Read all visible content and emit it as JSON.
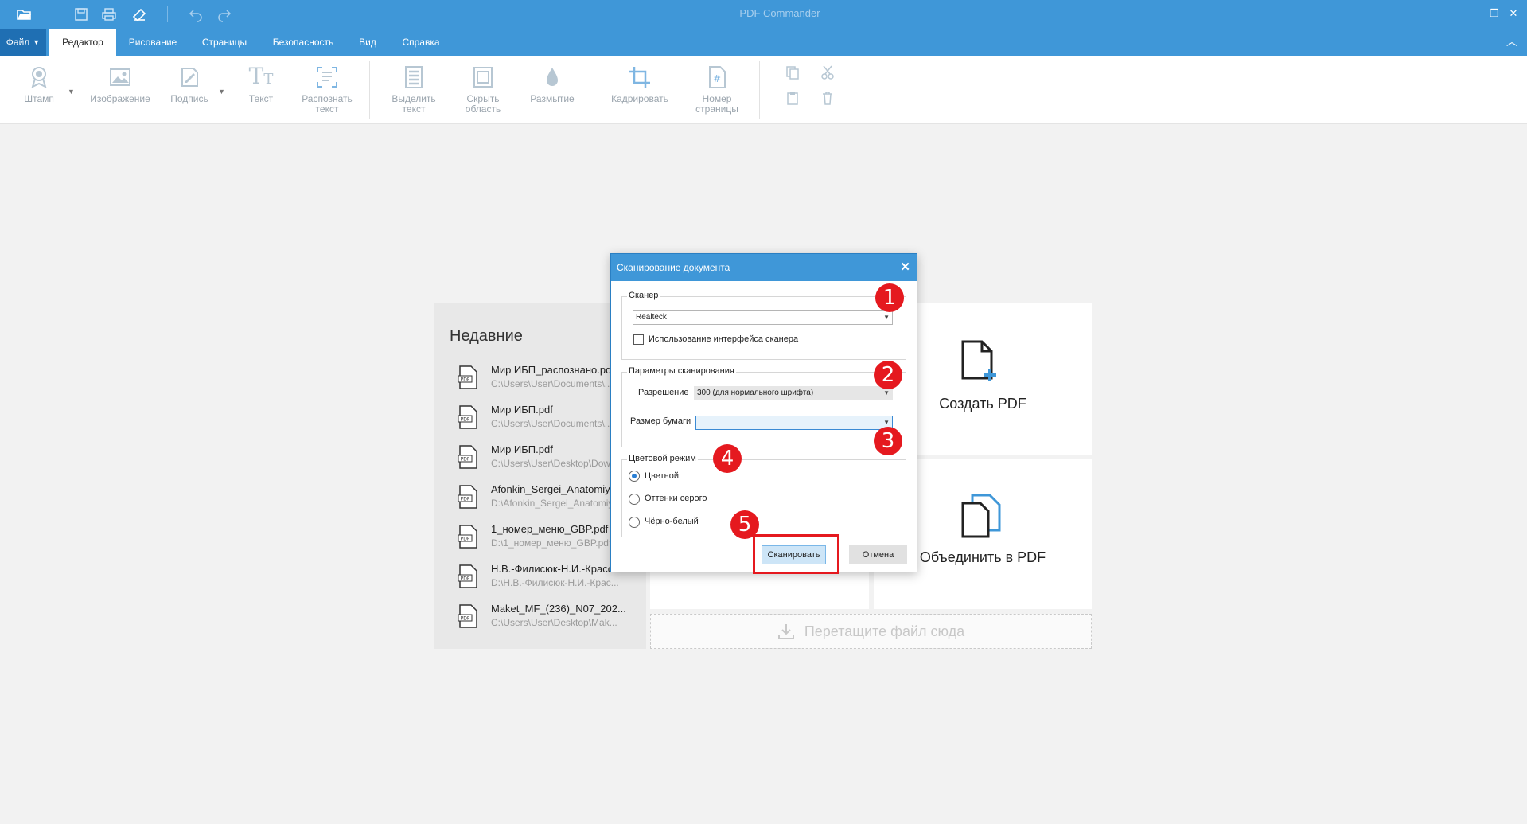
{
  "app": {
    "title": "PDF Commander"
  },
  "menu": {
    "file_label": "Файл",
    "tabs": [
      "Редактор",
      "Рисование",
      "Страницы",
      "Безопасность",
      "Вид",
      "Справка"
    ]
  },
  "ribbon": {
    "stamp": "Штамп",
    "image": "Изображение",
    "signature": "Подпись",
    "text": "Текст",
    "recognize": [
      "Распознать",
      "текст"
    ],
    "highlight": [
      "Выделить",
      "текст"
    ],
    "hide_area": [
      "Скрыть",
      "область"
    ],
    "blur": "Размытие",
    "crop": "Кадрировать",
    "page_number": [
      "Номер",
      "страницы"
    ]
  },
  "recent": {
    "title": "Недавние",
    "items": [
      {
        "name": "Мир ИБП_распознано.pdf",
        "path": "C:\\Users\\User\\Documents\\..."
      },
      {
        "name": "Мир ИБП.pdf",
        "path": "C:\\Users\\User\\Documents\\..."
      },
      {
        "name": "Мир ИБП.pdf",
        "path": "C:\\Users\\User\\Desktop\\Dow..."
      },
      {
        "name": "Afonkin_Sergei_Anatomiya...",
        "path": "D:\\Afonkin_Sergei_Anatomiy..."
      },
      {
        "name": "1_номер_меню_GBP.pdf",
        "path": "D:\\1_номер_меню_GBP.pdf"
      },
      {
        "name": "Н.В.-Филисюк-Н.И.-Красс...",
        "path": "D:\\Н.В.-Филисюк-Н.И.-Крас..."
      },
      {
        "name": "Maket_MF_(236)_N07_202...",
        "path": "C:\\Users\\User\\Desktop\\Mak..."
      }
    ]
  },
  "tiles": {
    "create_pdf": "Создать PDF",
    "merge_pdf": "Объединить в PDF",
    "dropzone": "Перетащите файл сюда"
  },
  "dialog": {
    "title": "Сканирование документа",
    "scanner_group": "Сканер",
    "scanner_value": "Realteck",
    "use_interface": "Использование интерфейса сканера",
    "params_group": "Параметры сканирования",
    "resolution_label": "Разрешение",
    "resolution_value": "300 (для нормального шрифта)",
    "paper_label": "Размер бумаги",
    "paper_value": "",
    "color_group": "Цветовой режим",
    "color_options": [
      "Цветной",
      "Оттенки серого",
      "Чёрно-белый"
    ],
    "selected_color": "Цветной",
    "scan_button": "Сканировать",
    "cancel_button": "Отмена"
  },
  "annotations": {
    "badges": [
      "1",
      "2",
      "3",
      "4",
      "5"
    ],
    "color": "#e5191f"
  },
  "colors": {
    "accent": "#3f97d8",
    "file_button": "#1f6fb3",
    "scan_button": "#cde5f7"
  }
}
